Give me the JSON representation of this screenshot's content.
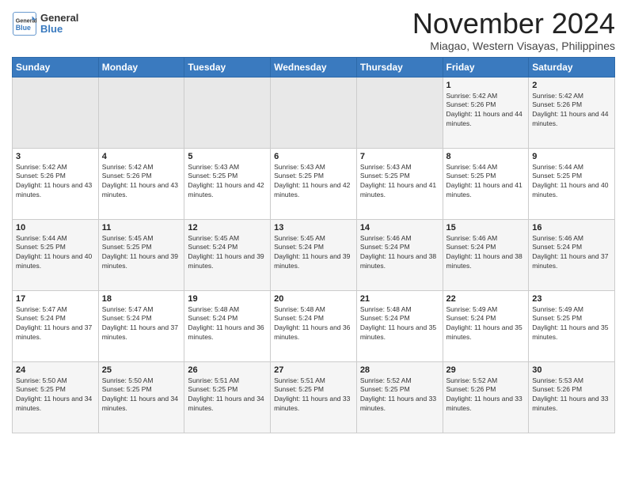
{
  "header": {
    "logo_line1": "General",
    "logo_line2": "Blue",
    "month": "November 2024",
    "location": "Miagao, Western Visayas, Philippines"
  },
  "weekdays": [
    "Sunday",
    "Monday",
    "Tuesday",
    "Wednesday",
    "Thursday",
    "Friday",
    "Saturday"
  ],
  "weeks": [
    [
      {
        "day": "",
        "info": ""
      },
      {
        "day": "",
        "info": ""
      },
      {
        "day": "",
        "info": ""
      },
      {
        "day": "",
        "info": ""
      },
      {
        "day": "",
        "info": ""
      },
      {
        "day": "1",
        "info": "Sunrise: 5:42 AM\nSunset: 5:26 PM\nDaylight: 11 hours and 44 minutes."
      },
      {
        "day": "2",
        "info": "Sunrise: 5:42 AM\nSunset: 5:26 PM\nDaylight: 11 hours and 44 minutes."
      }
    ],
    [
      {
        "day": "3",
        "info": "Sunrise: 5:42 AM\nSunset: 5:26 PM\nDaylight: 11 hours and 43 minutes."
      },
      {
        "day": "4",
        "info": "Sunrise: 5:42 AM\nSunset: 5:26 PM\nDaylight: 11 hours and 43 minutes."
      },
      {
        "day": "5",
        "info": "Sunrise: 5:43 AM\nSunset: 5:25 PM\nDaylight: 11 hours and 42 minutes."
      },
      {
        "day": "6",
        "info": "Sunrise: 5:43 AM\nSunset: 5:25 PM\nDaylight: 11 hours and 42 minutes."
      },
      {
        "day": "7",
        "info": "Sunrise: 5:43 AM\nSunset: 5:25 PM\nDaylight: 11 hours and 41 minutes."
      },
      {
        "day": "8",
        "info": "Sunrise: 5:44 AM\nSunset: 5:25 PM\nDaylight: 11 hours and 41 minutes."
      },
      {
        "day": "9",
        "info": "Sunrise: 5:44 AM\nSunset: 5:25 PM\nDaylight: 11 hours and 40 minutes."
      }
    ],
    [
      {
        "day": "10",
        "info": "Sunrise: 5:44 AM\nSunset: 5:25 PM\nDaylight: 11 hours and 40 minutes."
      },
      {
        "day": "11",
        "info": "Sunrise: 5:45 AM\nSunset: 5:25 PM\nDaylight: 11 hours and 39 minutes."
      },
      {
        "day": "12",
        "info": "Sunrise: 5:45 AM\nSunset: 5:24 PM\nDaylight: 11 hours and 39 minutes."
      },
      {
        "day": "13",
        "info": "Sunrise: 5:45 AM\nSunset: 5:24 PM\nDaylight: 11 hours and 39 minutes."
      },
      {
        "day": "14",
        "info": "Sunrise: 5:46 AM\nSunset: 5:24 PM\nDaylight: 11 hours and 38 minutes."
      },
      {
        "day": "15",
        "info": "Sunrise: 5:46 AM\nSunset: 5:24 PM\nDaylight: 11 hours and 38 minutes."
      },
      {
        "day": "16",
        "info": "Sunrise: 5:46 AM\nSunset: 5:24 PM\nDaylight: 11 hours and 37 minutes."
      }
    ],
    [
      {
        "day": "17",
        "info": "Sunrise: 5:47 AM\nSunset: 5:24 PM\nDaylight: 11 hours and 37 minutes."
      },
      {
        "day": "18",
        "info": "Sunrise: 5:47 AM\nSunset: 5:24 PM\nDaylight: 11 hours and 37 minutes."
      },
      {
        "day": "19",
        "info": "Sunrise: 5:48 AM\nSunset: 5:24 PM\nDaylight: 11 hours and 36 minutes."
      },
      {
        "day": "20",
        "info": "Sunrise: 5:48 AM\nSunset: 5:24 PM\nDaylight: 11 hours and 36 minutes."
      },
      {
        "day": "21",
        "info": "Sunrise: 5:48 AM\nSunset: 5:24 PM\nDaylight: 11 hours and 35 minutes."
      },
      {
        "day": "22",
        "info": "Sunrise: 5:49 AM\nSunset: 5:24 PM\nDaylight: 11 hours and 35 minutes."
      },
      {
        "day": "23",
        "info": "Sunrise: 5:49 AM\nSunset: 5:25 PM\nDaylight: 11 hours and 35 minutes."
      }
    ],
    [
      {
        "day": "24",
        "info": "Sunrise: 5:50 AM\nSunset: 5:25 PM\nDaylight: 11 hours and 34 minutes."
      },
      {
        "day": "25",
        "info": "Sunrise: 5:50 AM\nSunset: 5:25 PM\nDaylight: 11 hours and 34 minutes."
      },
      {
        "day": "26",
        "info": "Sunrise: 5:51 AM\nSunset: 5:25 PM\nDaylight: 11 hours and 34 minutes."
      },
      {
        "day": "27",
        "info": "Sunrise: 5:51 AM\nSunset: 5:25 PM\nDaylight: 11 hours and 33 minutes."
      },
      {
        "day": "28",
        "info": "Sunrise: 5:52 AM\nSunset: 5:25 PM\nDaylight: 11 hours and 33 minutes."
      },
      {
        "day": "29",
        "info": "Sunrise: 5:52 AM\nSunset: 5:26 PM\nDaylight: 11 hours and 33 minutes."
      },
      {
        "day": "30",
        "info": "Sunrise: 5:53 AM\nSunset: 5:26 PM\nDaylight: 11 hours and 33 minutes."
      }
    ]
  ]
}
